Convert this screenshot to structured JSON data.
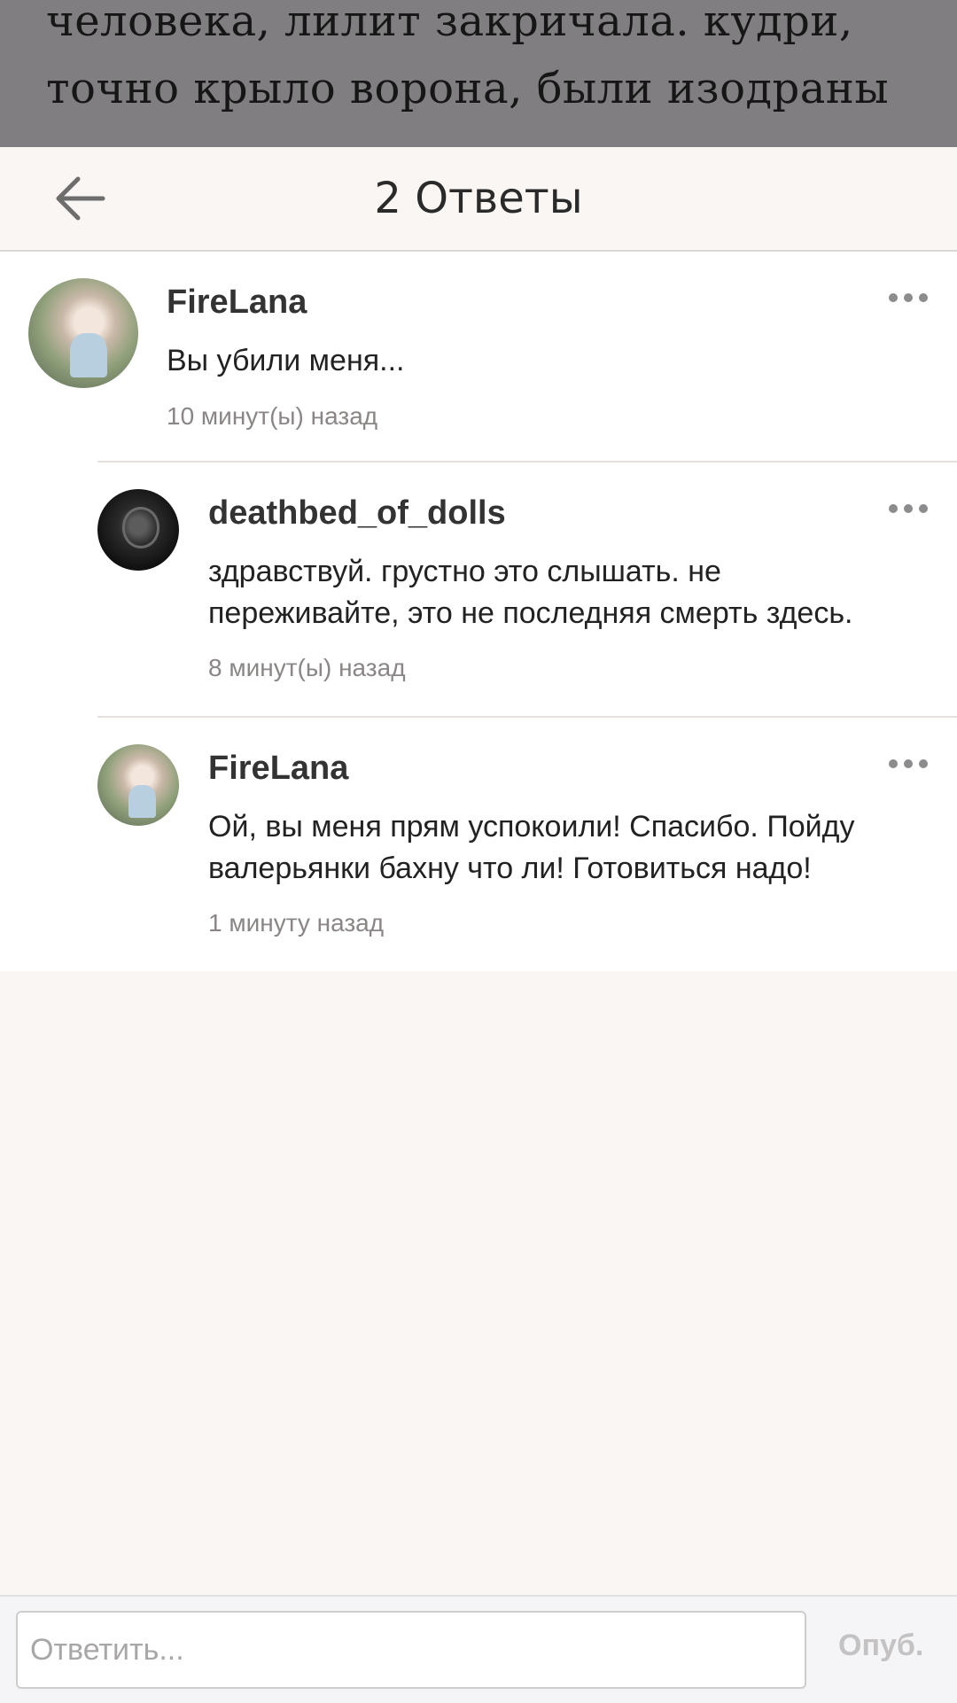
{
  "backdrop": {
    "lines": [
      "человека, лилит закричала. кудри,",
      "точно крыло ворона, были изодраны",
      "            ..."
    ]
  },
  "header": {
    "title": "2 Ответы"
  },
  "comments": [
    {
      "username": "FireLana",
      "text": "Вы убили меня...",
      "time": "10 минут(ы) назад"
    }
  ],
  "replies": [
    {
      "username": "deathbed_of_dolls",
      "text": "здравствуй. грустно это слышать. не\nпереживайте, это не последняя смерть здесь.",
      "time": "8 минут(ы) назад"
    },
    {
      "username": "FireLana",
      "text": "Ой, вы меня прям успокоили! Спасибо. Пойду\nвалерьянки бахну что ли! Готовиться надо!",
      "time": "1 минуту назад"
    }
  ],
  "footer": {
    "placeholder": "Ответить...",
    "publish_label": "Опуб."
  },
  "icons": {
    "back": "arrow-left-icon",
    "more": "more-horizontal-icon"
  },
  "colors": {
    "backdrop": "#807e80",
    "header_bg": "#f9f6f4",
    "timestamp": "#8a8685",
    "publish_disabled": "#c4c2c3"
  }
}
